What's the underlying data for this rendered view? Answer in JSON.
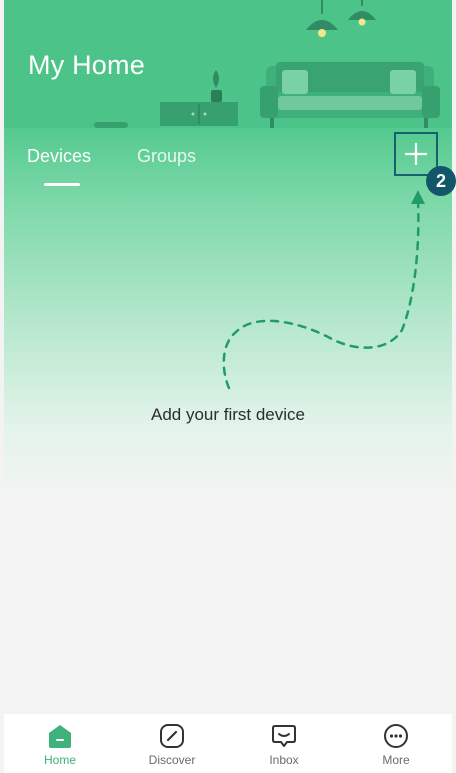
{
  "app": {
    "title": "My Home"
  },
  "tabs": [
    {
      "label": "Devices",
      "active": true
    },
    {
      "label": "Groups",
      "active": false
    }
  ],
  "actions": {
    "add_icon": "plus-icon",
    "step_badge": "2"
  },
  "empty_state": {
    "message": "Add your first device"
  },
  "bottom_nav": [
    {
      "label": "Home",
      "icon": "home-icon",
      "active": true
    },
    {
      "label": "Discover",
      "icon": "compass-icon",
      "active": false
    },
    {
      "label": "Inbox",
      "icon": "inbox-icon",
      "active": false
    },
    {
      "label": "More",
      "icon": "more-icon",
      "active": false
    }
  ],
  "colors": {
    "accent": "#4cc489",
    "highlight": "#17606f",
    "nav_active": "#3fb17a"
  }
}
